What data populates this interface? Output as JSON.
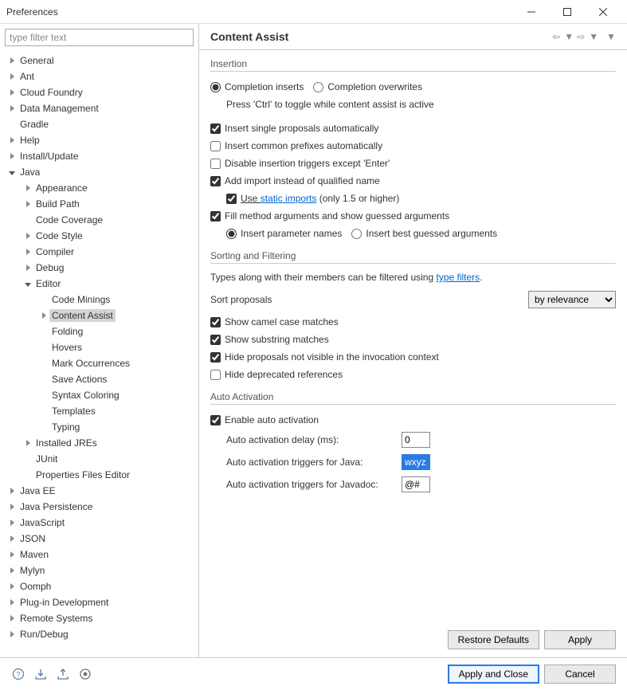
{
  "window": {
    "title": "Preferences"
  },
  "filter": {
    "placeholder": "type filter text"
  },
  "tree": [
    {
      "label": "General",
      "depth": 0,
      "expandable": true,
      "expanded": false
    },
    {
      "label": "Ant",
      "depth": 0,
      "expandable": true,
      "expanded": false
    },
    {
      "label": "Cloud Foundry",
      "depth": 0,
      "expandable": true,
      "expanded": false
    },
    {
      "label": "Data Management",
      "depth": 0,
      "expandable": true,
      "expanded": false
    },
    {
      "label": "Gradle",
      "depth": 0,
      "expandable": false
    },
    {
      "label": "Help",
      "depth": 0,
      "expandable": true,
      "expanded": false
    },
    {
      "label": "Install/Update",
      "depth": 0,
      "expandable": true,
      "expanded": false
    },
    {
      "label": "Java",
      "depth": 0,
      "expandable": true,
      "expanded": true
    },
    {
      "label": "Appearance",
      "depth": 1,
      "expandable": true,
      "expanded": false
    },
    {
      "label": "Build Path",
      "depth": 1,
      "expandable": true,
      "expanded": false
    },
    {
      "label": "Code Coverage",
      "depth": 1,
      "expandable": false
    },
    {
      "label": "Code Style",
      "depth": 1,
      "expandable": true,
      "expanded": false
    },
    {
      "label": "Compiler",
      "depth": 1,
      "expandable": true,
      "expanded": false
    },
    {
      "label": "Debug",
      "depth": 1,
      "expandable": true,
      "expanded": false
    },
    {
      "label": "Editor",
      "depth": 1,
      "expandable": true,
      "expanded": true
    },
    {
      "label": "Code Minings",
      "depth": 2,
      "expandable": false
    },
    {
      "label": "Content Assist",
      "depth": 2,
      "expandable": true,
      "expanded": false,
      "selected": true
    },
    {
      "label": "Folding",
      "depth": 2,
      "expandable": false
    },
    {
      "label": "Hovers",
      "depth": 2,
      "expandable": false
    },
    {
      "label": "Mark Occurrences",
      "depth": 2,
      "expandable": false
    },
    {
      "label": "Save Actions",
      "depth": 2,
      "expandable": false
    },
    {
      "label": "Syntax Coloring",
      "depth": 2,
      "expandable": false
    },
    {
      "label": "Templates",
      "depth": 2,
      "expandable": false
    },
    {
      "label": "Typing",
      "depth": 2,
      "expandable": false
    },
    {
      "label": "Installed JREs",
      "depth": 1,
      "expandable": true,
      "expanded": false
    },
    {
      "label": "JUnit",
      "depth": 1,
      "expandable": false
    },
    {
      "label": "Properties Files Editor",
      "depth": 1,
      "expandable": false
    },
    {
      "label": "Java EE",
      "depth": 0,
      "expandable": true,
      "expanded": false
    },
    {
      "label": "Java Persistence",
      "depth": 0,
      "expandable": true,
      "expanded": false
    },
    {
      "label": "JavaScript",
      "depth": 0,
      "expandable": true,
      "expanded": false
    },
    {
      "label": "JSON",
      "depth": 0,
      "expandable": true,
      "expanded": false
    },
    {
      "label": "Maven",
      "depth": 0,
      "expandable": true,
      "expanded": false
    },
    {
      "label": "Mylyn",
      "depth": 0,
      "expandable": true,
      "expanded": false
    },
    {
      "label": "Oomph",
      "depth": 0,
      "expandable": true,
      "expanded": false
    },
    {
      "label": "Plug-in Development",
      "depth": 0,
      "expandable": true,
      "expanded": false
    },
    {
      "label": "Remote Systems",
      "depth": 0,
      "expandable": true,
      "expanded": false
    },
    {
      "label": "Run/Debug",
      "depth": 0,
      "expandable": true,
      "expanded": false
    }
  ],
  "header": {
    "title": "Content Assist"
  },
  "insertion": {
    "group": "Insertion",
    "radio_inserts": "Completion inserts",
    "radio_overwrites": "Completion overwrites",
    "hint": "Press 'Ctrl' to toggle while content assist is active",
    "cb_single": "Insert single proposals automatically",
    "cb_prefixes": "Insert common prefixes automatically",
    "cb_disable": "Disable insertion triggers except 'Enter'",
    "cb_addimport": "Add import instead of qualified name",
    "cb_use": "Use ",
    "link_static": "static imports",
    "suffix_static": " (only 1.5 or higher)",
    "cb_fill": "Fill method arguments and show guessed arguments",
    "radio_param": "Insert parameter names",
    "radio_best": "Insert best guessed arguments"
  },
  "sorting": {
    "group": "Sorting and Filtering",
    "hint_pre": "Types along with their members can be filtered using ",
    "link": "type filters",
    "hint_post": ".",
    "sort_label": "Sort proposals",
    "sort_value": "by relevance",
    "cb_camel": "Show camel case matches",
    "cb_substring": "Show substring matches",
    "cb_hide_invoc": "Hide proposals not visible in the invocation context",
    "cb_hide_dep": "Hide deprecated references"
  },
  "auto": {
    "group": "Auto Activation",
    "cb_enable": "Enable auto activation",
    "lbl_delay": "Auto activation delay (ms):",
    "val_delay": "0",
    "lbl_java": "Auto activation triggers for Java:",
    "val_java": "wxyz.",
    "lbl_javadoc": "Auto activation triggers for Javadoc:",
    "val_javadoc": "@#"
  },
  "buttons": {
    "restore": "Restore Defaults",
    "apply": "Apply",
    "apply_close": "Apply and Close",
    "cancel": "Cancel"
  }
}
